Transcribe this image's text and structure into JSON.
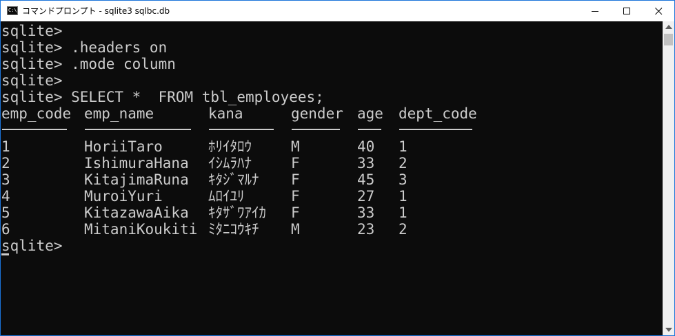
{
  "window": {
    "title": "コマンドプロンプト - sqlite3  sqlbc.db",
    "icon_label": "C:\\",
    "icons": {
      "minimize": "minimize-icon",
      "maximize": "maximize-icon",
      "close": "close-icon"
    }
  },
  "console": {
    "lines": [
      "sqlite>",
      "sqlite> .headers on",
      "sqlite> .mode column",
      "sqlite>",
      "sqlite> SELECT *  FROM tbl_employees;"
    ],
    "headers": [
      "emp_code",
      "emp_name",
      "kana",
      "gender",
      "age",
      "dept_code"
    ],
    "rows": [
      [
        "1",
        "HoriiTaro",
        "ﾎﾘｲﾀﾛｳ",
        "M",
        "40",
        "1"
      ],
      [
        "2",
        "IshimuraHana",
        "ｲｼﾑﾗﾊﾅ",
        "F",
        "33",
        "2"
      ],
      [
        "3",
        "KitajimaRuna",
        "ｷﾀｼﾞﾏﾙﾅ",
        "F",
        "45",
        "3"
      ],
      [
        "4",
        "MuroiYuri",
        "ﾑﾛｲﾕﾘ",
        "F",
        "27",
        "1"
      ],
      [
        "5",
        "KitazawaAika",
        "ｷﾀｻﾞﾜｱｲｶ",
        "F",
        "33",
        "1"
      ],
      [
        "6",
        "MitaniKoukiti",
        "ﾐﾀﾆｺｳｷﾁ",
        "M",
        "23",
        "2"
      ]
    ],
    "prompt": "sqlite>"
  },
  "colors": {
    "background": "#0c0c0c",
    "text": "#cccccc",
    "title_bar": "#ffffff",
    "border": "#1a73d9"
  }
}
